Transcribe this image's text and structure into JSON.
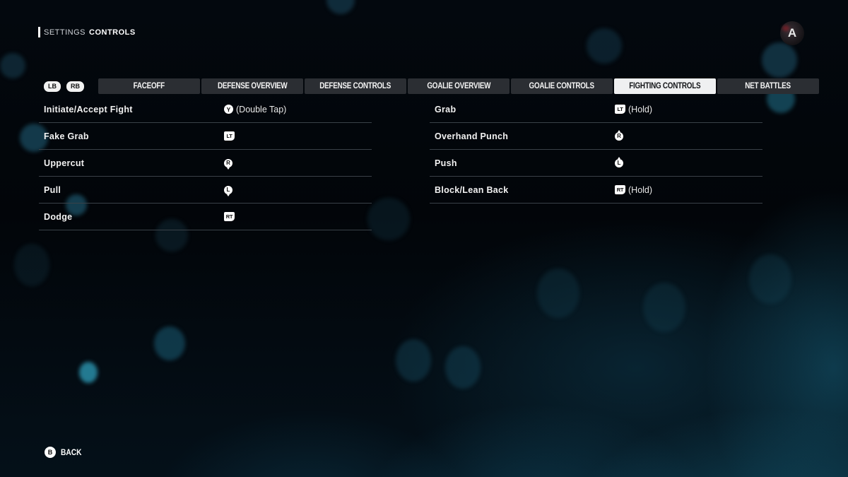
{
  "header": {
    "section": "SETTINGS",
    "page": "CONTROLS"
  },
  "logo": {
    "icon": "game-logo-icon",
    "glyph": "A"
  },
  "bumpers": {
    "left": "LB",
    "right": "RB"
  },
  "tabs": [
    {
      "label": "FACEOFF",
      "active": false
    },
    {
      "label": "DEFENSE OVERVIEW",
      "active": false
    },
    {
      "label": "DEFENSE CONTROLS",
      "active": false
    },
    {
      "label": "GOALIE OVERVIEW",
      "active": false
    },
    {
      "label": "GOALIE CONTROLS",
      "active": false
    },
    {
      "label": "FIGHTING CONTROLS",
      "active": true
    },
    {
      "label": "NET BATTLES",
      "active": false
    }
  ],
  "controls_left": [
    {
      "action": "Initiate/Accept Fight",
      "button": "Y",
      "button_type": "face",
      "modifier": "(Double Tap)"
    },
    {
      "action": "Fake Grab",
      "button": "LT",
      "button_type": "trigger",
      "modifier": ""
    },
    {
      "action": "Uppercut",
      "button": "R",
      "button_type": "stick-down",
      "modifier": ""
    },
    {
      "action": "Pull",
      "button": "L",
      "button_type": "stick-down",
      "modifier": ""
    },
    {
      "action": "Dodge",
      "button": "RT",
      "button_type": "trigger",
      "modifier": ""
    }
  ],
  "controls_right": [
    {
      "action": "Grab",
      "button": "LT",
      "button_type": "trigger",
      "modifier": "(Hold)"
    },
    {
      "action": "Overhand Punch",
      "button": "R",
      "button_type": "stick-up",
      "modifier": ""
    },
    {
      "action": "Push",
      "button": "L",
      "button_type": "stick-up",
      "modifier": ""
    },
    {
      "action": "Block/Lean Back",
      "button": "RT",
      "button_type": "trigger",
      "modifier": "(Hold)"
    }
  ],
  "footer": {
    "back_button": "B",
    "back_label": "BACK"
  },
  "colors": {
    "active_tab_bg": "#eff0f1",
    "tab_bg": "#2b2e33",
    "divider": "#3a4148",
    "background_accent": "#1c7896"
  }
}
